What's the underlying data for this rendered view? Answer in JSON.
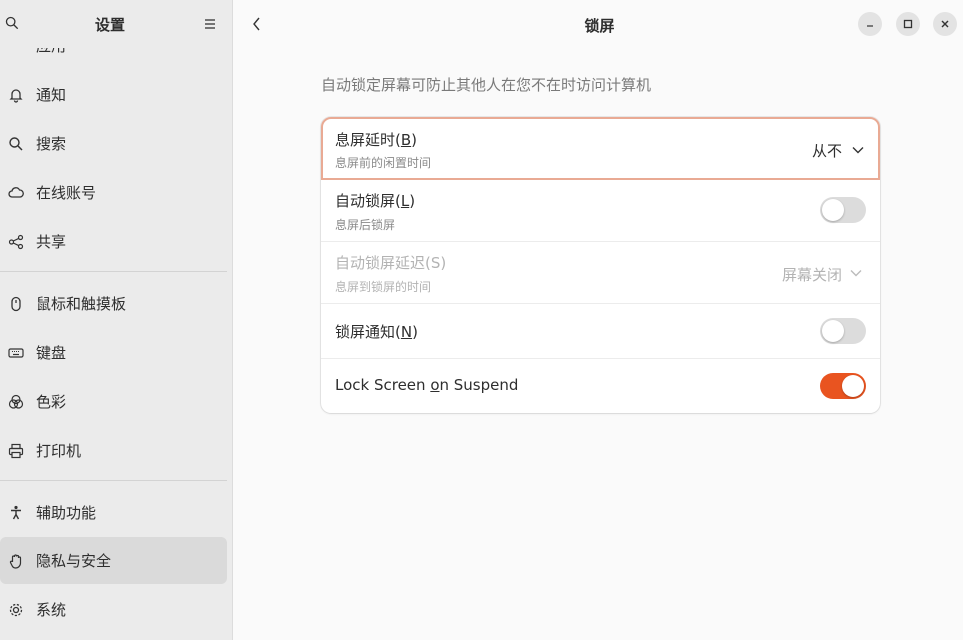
{
  "sidebar": {
    "title": "设置",
    "items": [
      {
        "label": "应用",
        "icon": "apps-icon"
      },
      {
        "label": "通知",
        "icon": "bell-icon"
      },
      {
        "label": "搜索",
        "icon": "search-icon"
      },
      {
        "label": "在线账号",
        "icon": "cloud-icon"
      },
      {
        "label": "共享",
        "icon": "share-icon"
      },
      {
        "label": "鼠标和触摸板",
        "icon": "mouse-icon"
      },
      {
        "label": "键盘",
        "icon": "keyboard-icon"
      },
      {
        "label": "色彩",
        "icon": "color-icon"
      },
      {
        "label": "打印机",
        "icon": "printer-icon"
      },
      {
        "label": "辅助功能",
        "icon": "accessibility-icon"
      },
      {
        "label": "隐私与安全",
        "icon": "hand-icon",
        "active": true
      },
      {
        "label": "系统",
        "icon": "gear-icon"
      }
    ]
  },
  "header": {
    "title": "锁屏"
  },
  "main": {
    "description": "自动锁定屏幕可防止其他人在您不在时访问计算机",
    "rows": [
      {
        "title_pre": "息屏延时(",
        "title_key": "B",
        "title_post": ")",
        "subtitle": "息屏前的闲置时间",
        "value": "从不"
      },
      {
        "title_pre": "自动锁屏(",
        "title_key": "L",
        "title_post": ")",
        "subtitle": "息屏后锁屏",
        "toggle_state": "off"
      },
      {
        "title_pre": "自动锁屏延迟(S)",
        "title_key": "",
        "title_post": "",
        "subtitle": "息屏到锁屏的时间",
        "value": "屏幕关闭",
        "disabled": true
      },
      {
        "title_pre": "锁屏通知(",
        "title_key": "N",
        "title_post": ")",
        "toggle_state": "off"
      },
      {
        "title_pre": "Lock Screen ",
        "title_key": "o",
        "title_post": "n Suspend",
        "toggle_state": "on"
      }
    ]
  },
  "colors": {
    "accent": "#e95420",
    "focus_border": "#e9aa94"
  }
}
